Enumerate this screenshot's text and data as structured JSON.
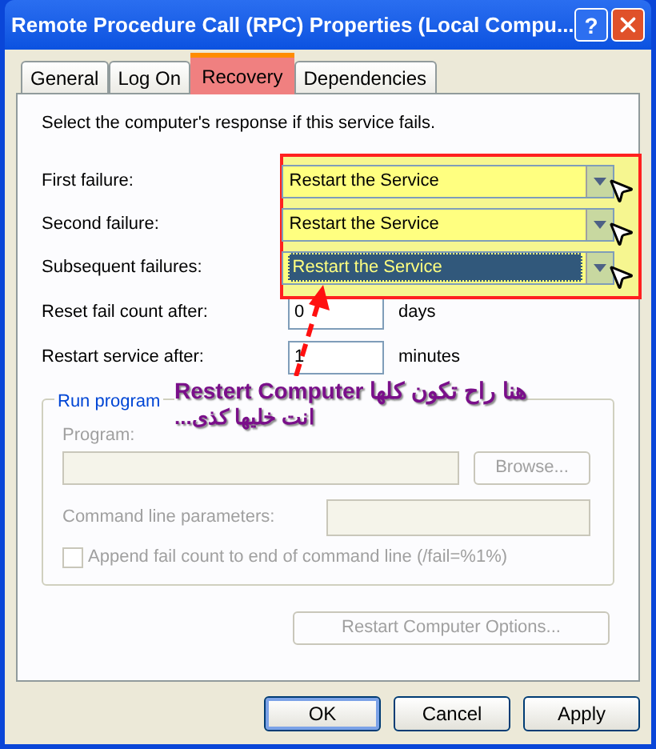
{
  "window": {
    "title": "Remote Procedure Call (RPC) Properties (Local Compu...",
    "help": "?"
  },
  "tabs": [
    {
      "label": "General",
      "selected": false
    },
    {
      "label": "Log On",
      "selected": false
    },
    {
      "label": "Recovery",
      "selected": true
    },
    {
      "label": "Dependencies",
      "selected": false
    }
  ],
  "intro": "Select the computer's response if this service fails.",
  "failures": [
    {
      "label": "First failure:",
      "value": "Restart the Service",
      "selected": false
    },
    {
      "label": "Second failure:",
      "value": "Restart the Service",
      "selected": false
    },
    {
      "label": "Subsequent failures:",
      "value": "Restart the Service",
      "selected": true
    }
  ],
  "counts": [
    {
      "label": "Reset fail count after:",
      "value": "0",
      "unit": "days"
    },
    {
      "label": "Restart service after:",
      "value": "1",
      "unit": "minutes"
    }
  ],
  "run_program": {
    "title": "Run program",
    "disabled": true,
    "program_label": "Program:",
    "browse": "Browse...",
    "params_label": "Command line parameters:",
    "append": {
      "label": "Append fail count to end of command line (/fail=%1%)",
      "checked": false
    }
  },
  "restart_options": {
    "label": "Restart Computer Options...",
    "disabled": true
  },
  "annotation": {
    "line_1": "هنا راح تكون كلها Restert Computer",
    "line_2": "انت خليها كذى..."
  },
  "buttons": [
    {
      "label": "OK",
      "selected": true
    },
    {
      "label": "Cancel",
      "selected": false
    },
    {
      "label": "Apply",
      "selected": false
    }
  ]
}
